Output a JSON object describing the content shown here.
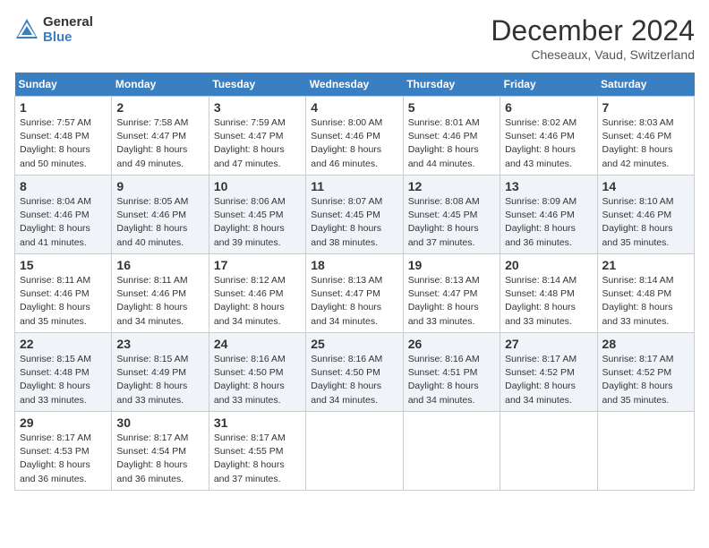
{
  "header": {
    "logo_line1": "General",
    "logo_line2": "Blue",
    "month": "December 2024",
    "location": "Cheseaux, Vaud, Switzerland"
  },
  "weekdays": [
    "Sunday",
    "Monday",
    "Tuesday",
    "Wednesday",
    "Thursday",
    "Friday",
    "Saturday"
  ],
  "weeks": [
    [
      {
        "day": "1",
        "rise": "7:57 AM",
        "set": "4:48 PM",
        "hours": "8 hours and 50 minutes."
      },
      {
        "day": "2",
        "rise": "7:58 AM",
        "set": "4:47 PM",
        "hours": "8 hours and 49 minutes."
      },
      {
        "day": "3",
        "rise": "7:59 AM",
        "set": "4:47 PM",
        "hours": "8 hours and 47 minutes."
      },
      {
        "day": "4",
        "rise": "8:00 AM",
        "set": "4:46 PM",
        "hours": "8 hours and 46 minutes."
      },
      {
        "day": "5",
        "rise": "8:01 AM",
        "set": "4:46 PM",
        "hours": "8 hours and 44 minutes."
      },
      {
        "day": "6",
        "rise": "8:02 AM",
        "set": "4:46 PM",
        "hours": "8 hours and 43 minutes."
      },
      {
        "day": "7",
        "rise": "8:03 AM",
        "set": "4:46 PM",
        "hours": "8 hours and 42 minutes."
      }
    ],
    [
      {
        "day": "8",
        "rise": "8:04 AM",
        "set": "4:46 PM",
        "hours": "8 hours and 41 minutes."
      },
      {
        "day": "9",
        "rise": "8:05 AM",
        "set": "4:46 PM",
        "hours": "8 hours and 40 minutes."
      },
      {
        "day": "10",
        "rise": "8:06 AM",
        "set": "4:45 PM",
        "hours": "8 hours and 39 minutes."
      },
      {
        "day": "11",
        "rise": "8:07 AM",
        "set": "4:45 PM",
        "hours": "8 hours and 38 minutes."
      },
      {
        "day": "12",
        "rise": "8:08 AM",
        "set": "4:45 PM",
        "hours": "8 hours and 37 minutes."
      },
      {
        "day": "13",
        "rise": "8:09 AM",
        "set": "4:46 PM",
        "hours": "8 hours and 36 minutes."
      },
      {
        "day": "14",
        "rise": "8:10 AM",
        "set": "4:46 PM",
        "hours": "8 hours and 35 minutes."
      }
    ],
    [
      {
        "day": "15",
        "rise": "8:11 AM",
        "set": "4:46 PM",
        "hours": "8 hours and 35 minutes."
      },
      {
        "day": "16",
        "rise": "8:11 AM",
        "set": "4:46 PM",
        "hours": "8 hours and 34 minutes."
      },
      {
        "day": "17",
        "rise": "8:12 AM",
        "set": "4:46 PM",
        "hours": "8 hours and 34 minutes."
      },
      {
        "day": "18",
        "rise": "8:13 AM",
        "set": "4:47 PM",
        "hours": "8 hours and 34 minutes."
      },
      {
        "day": "19",
        "rise": "8:13 AM",
        "set": "4:47 PM",
        "hours": "8 hours and 33 minutes."
      },
      {
        "day": "20",
        "rise": "8:14 AM",
        "set": "4:48 PM",
        "hours": "8 hours and 33 minutes."
      },
      {
        "day": "21",
        "rise": "8:14 AM",
        "set": "4:48 PM",
        "hours": "8 hours and 33 minutes."
      }
    ],
    [
      {
        "day": "22",
        "rise": "8:15 AM",
        "set": "4:48 PM",
        "hours": "8 hours and 33 minutes."
      },
      {
        "day": "23",
        "rise": "8:15 AM",
        "set": "4:49 PM",
        "hours": "8 hours and 33 minutes."
      },
      {
        "day": "24",
        "rise": "8:16 AM",
        "set": "4:50 PM",
        "hours": "8 hours and 33 minutes."
      },
      {
        "day": "25",
        "rise": "8:16 AM",
        "set": "4:50 PM",
        "hours": "8 hours and 34 minutes."
      },
      {
        "day": "26",
        "rise": "8:16 AM",
        "set": "4:51 PM",
        "hours": "8 hours and 34 minutes."
      },
      {
        "day": "27",
        "rise": "8:17 AM",
        "set": "4:52 PM",
        "hours": "8 hours and 34 minutes."
      },
      {
        "day": "28",
        "rise": "8:17 AM",
        "set": "4:52 PM",
        "hours": "8 hours and 35 minutes."
      }
    ],
    [
      {
        "day": "29",
        "rise": "8:17 AM",
        "set": "4:53 PM",
        "hours": "8 hours and 36 minutes."
      },
      {
        "day": "30",
        "rise": "8:17 AM",
        "set": "4:54 PM",
        "hours": "8 hours and 36 minutes."
      },
      {
        "day": "31",
        "rise": "8:17 AM",
        "set": "4:55 PM",
        "hours": "8 hours and 37 minutes."
      },
      null,
      null,
      null,
      null
    ]
  ]
}
